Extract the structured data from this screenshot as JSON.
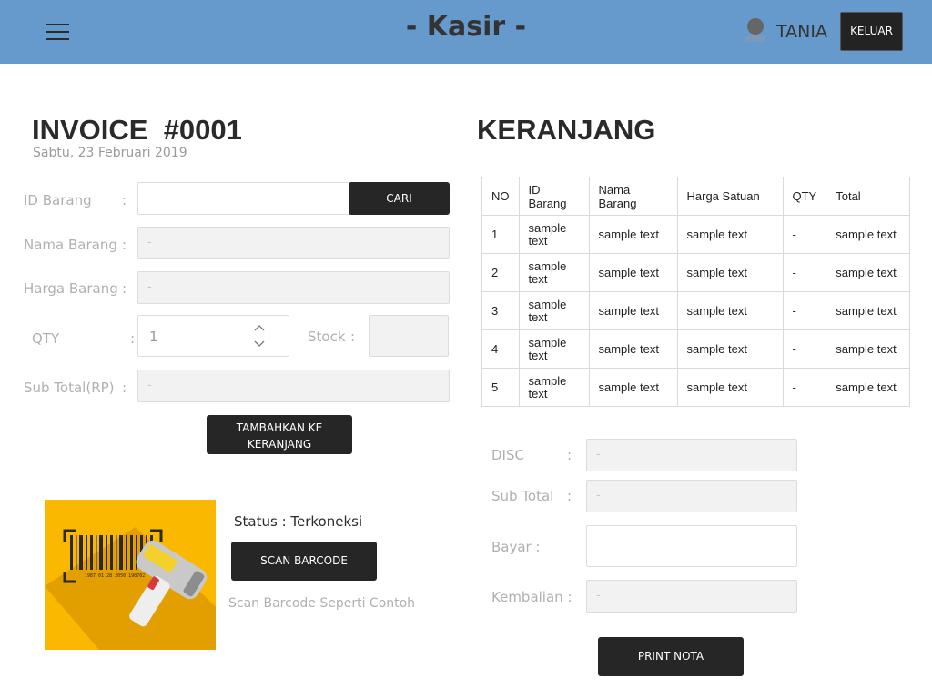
{
  "header": {
    "menu_icon": "hamburger-icon",
    "title": "- Kasir -",
    "user_icon": "user-icon",
    "user_name": "TANIA",
    "logout_label": "KELUAR",
    "bg_color": "#6699cc"
  },
  "invoice": {
    "title": "INVOICE  #0001",
    "date": "Sabtu, 23 Februari 2019",
    "id_barang": {
      "label": "ID Barang",
      "colon": ":",
      "value": ""
    },
    "search_label": "CARI",
    "nama_barang": {
      "label": "Nama Barang",
      "colon": ":",
      "value": "-"
    },
    "harga_barang": {
      "label": "Harga Barang",
      "colon": ":",
      "value": "-"
    },
    "qty": {
      "label": "QTY",
      "colon": ":",
      "value": "1"
    },
    "stock": {
      "label": "Stock",
      "colon": ":",
      "value": ""
    },
    "sub_total": {
      "label": "Sub Total(RP)",
      "colon": ":",
      "value": "-"
    },
    "add_to_cart_label": "TAMBAHKAN KE KERANJANG"
  },
  "barcode": {
    "image_icon": "barcode-scanner-icon",
    "image_text": "1987 01 28 2050 198702",
    "status": "Status : Terkoneksi",
    "scan_label": "SCAN BARCODE",
    "hint": "Scan Barcode Seperti Contoh"
  },
  "cart": {
    "title": "KERANJANG",
    "columns": [
      "NO",
      "ID Barang",
      "Nama Barang",
      "Harga Satuan",
      "QTY",
      "Total"
    ],
    "rows": [
      [
        "1",
        "sample text",
        "sample text",
        "sample text",
        "-",
        "sample text"
      ],
      [
        "2",
        "sample text",
        "sample text",
        "sample text",
        "-",
        "sample text"
      ],
      [
        "3",
        "sample text",
        "sample text",
        "sample text",
        "-",
        "sample text"
      ],
      [
        "4",
        "sample text",
        "sample text",
        "sample text",
        "-",
        "sample text"
      ],
      [
        "5",
        "sample text",
        "sample text",
        "sample text",
        "-",
        "sample text"
      ]
    ],
    "disc": {
      "label": "DISC",
      "colon": ":",
      "value": "-"
    },
    "sub_total": {
      "label": "Sub Total",
      "colon": ":",
      "value": "-"
    },
    "bayar": {
      "label": "Bayar :",
      "value": ""
    },
    "kembalian": {
      "label": "Kembalian :",
      "value": "-"
    },
    "print_label": "PRINT NOTA"
  }
}
